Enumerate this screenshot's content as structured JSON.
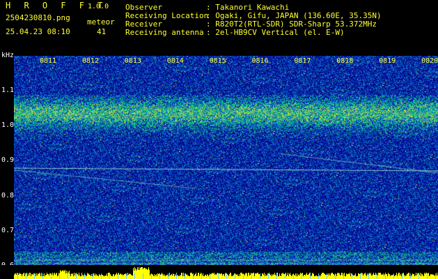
{
  "app": {
    "brand": "H R O F F T",
    "version": "1.0.0",
    "filename": "2504230810.png",
    "datetime": "25.04.23 08:10",
    "meteor_label": "meteor",
    "meteor_count": "41"
  },
  "info": {
    "rows": [
      {
        "label": "Observer",
        "value": ": Takanori Kawachi"
      },
      {
        "label": "Receiving Location",
        "value": ": Ogaki, Gifu, JAPAN (136.60E, 35.35N)"
      },
      {
        "label": "Receiver",
        "value": ": R820T2(RTL-SDR) SDR-Sharp 53.372MHz"
      },
      {
        "label": "Receiving antenna",
        "value": ": 2el-HB9CV Vertical (el. E-W)"
      }
    ]
  },
  "axis": {
    "unit": "kHz",
    "y_ticks": [
      "1.1",
      "1.0",
      "0.9",
      "0.8",
      "0.7",
      "0.6"
    ],
    "x_ticks": [
      "0811",
      "0812",
      "0813",
      "0814",
      "0815",
      "0816",
      "0817",
      "0818",
      "0819",
      "0820"
    ]
  },
  "colors": {
    "background": "#000000",
    "label_yellow": "#ffff33",
    "spectro_base": "#0a1a8a",
    "signal_band": "#22cc66",
    "footer_bar": "#ffff00"
  }
}
